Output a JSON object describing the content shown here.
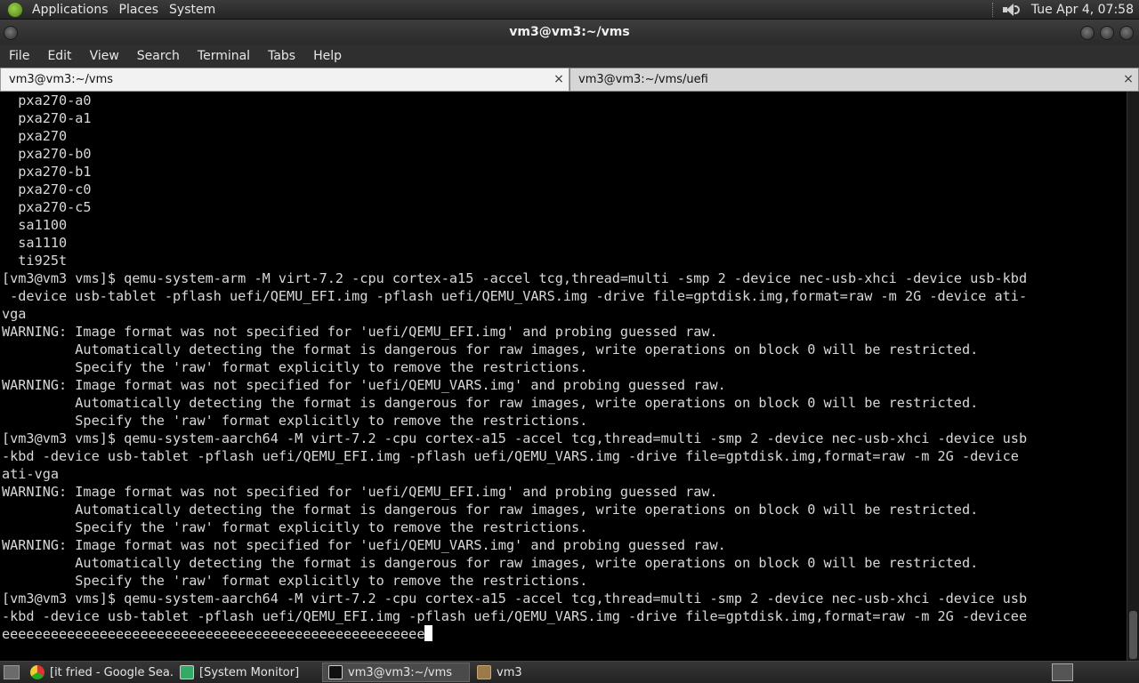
{
  "top_panel": {
    "menus": [
      "Applications",
      "Places",
      "System"
    ],
    "clock": "Tue Apr  4, 07:58"
  },
  "window": {
    "title": "vm3@vm3:~/vms"
  },
  "menubar": {
    "items": [
      "File",
      "Edit",
      "View",
      "Search",
      "Terminal",
      "Tabs",
      "Help"
    ]
  },
  "tabs": [
    {
      "label": "vm3@vm3:~/vms",
      "close": "×"
    },
    {
      "label": "vm3@vm3:~/vms/uefi",
      "close": "×"
    }
  ],
  "terminal": {
    "lines": [
      "  pxa270-a0",
      "  pxa270-a1",
      "  pxa270",
      "  pxa270-b0",
      "  pxa270-b1",
      "  pxa270-c0",
      "  pxa270-c5",
      "  sa1100",
      "  sa1110",
      "  ti925t",
      "[vm3@vm3 vms]$ qemu-system-arm -M virt-7.2 -cpu cortex-a15 -accel tcg,thread=multi -smp 2 -device nec-usb-xhci -device usb-kbd",
      " -device usb-tablet -pflash uefi/QEMU_EFI.img -pflash uefi/QEMU_VARS.img -drive file=gptdisk.img,format=raw -m 2G -device ati-",
      "vga",
      "WARNING: Image format was not specified for 'uefi/QEMU_EFI.img' and probing guessed raw.",
      "         Automatically detecting the format is dangerous for raw images, write operations on block 0 will be restricted.",
      "         Specify the 'raw' format explicitly to remove the restrictions.",
      "WARNING: Image format was not specified for 'uefi/QEMU_VARS.img' and probing guessed raw.",
      "         Automatically detecting the format is dangerous for raw images, write operations on block 0 will be restricted.",
      "         Specify the 'raw' format explicitly to remove the restrictions.",
      "[vm3@vm3 vms]$ qemu-system-aarch64 -M virt-7.2 -cpu cortex-a15 -accel tcg,thread=multi -smp 2 -device nec-usb-xhci -device usb",
      "-kbd -device usb-tablet -pflash uefi/QEMU_EFI.img -pflash uefi/QEMU_VARS.img -drive file=gptdisk.img,format=raw -m 2G -device",
      "ati-vga",
      "WARNING: Image format was not specified for 'uefi/QEMU_EFI.img' and probing guessed raw.",
      "         Automatically detecting the format is dangerous for raw images, write operations on block 0 will be restricted.",
      "         Specify the 'raw' format explicitly to remove the restrictions.",
      "WARNING: Image format was not specified for 'uefi/QEMU_VARS.img' and probing guessed raw.",
      "         Automatically detecting the format is dangerous for raw images, write operations on block 0 will be restricted.",
      "         Specify the 'raw' format explicitly to remove the restrictions.",
      "[vm3@vm3 vms]$ qemu-system-aarch64 -M virt-7.2 -cpu cortex-a15 -accel tcg,thread=multi -smp 2 -device nec-usb-xhci -device usb",
      "-kbd -device usb-tablet -pflash uefi/QEMU_EFI.img -pflash uefi/QEMU_VARS.img -drive file=gptdisk.img,format=raw -m 2G -devicee"
    ],
    "input_line": "eeeeeeeeeeeeeeeeeeeeeeeeeeeeeeeeeeeeeeeeeeeeeeeeeeee"
  },
  "taskbar": {
    "tasks": [
      {
        "label": "[it fried - Google Sea...",
        "icon": "chrome-icon"
      },
      {
        "label": "[System Monitor]",
        "icon": "system-monitor-icon"
      },
      {
        "label": "vm3@vm3:~/vms",
        "icon": "terminal-icon"
      },
      {
        "label": "vm3",
        "icon": "folder-icon"
      }
    ]
  }
}
